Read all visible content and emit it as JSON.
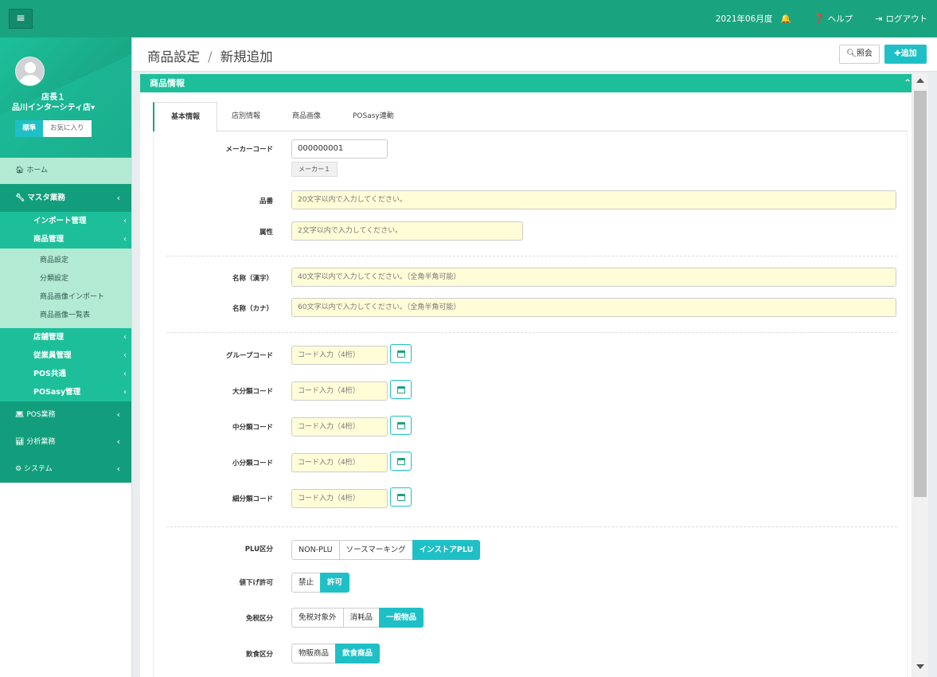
{
  "topbar": {
    "menu_icon": "hamburger-icon",
    "fiscal_period": "2021年06月度",
    "bell_icon": "bell-icon",
    "help_label": "ヘルプ",
    "logout_label": "ログアウト"
  },
  "sidebar": {
    "user_name": "店長１",
    "store_name": "品川インターシティ店▾",
    "fav_tabs": {
      "standard": "標準",
      "favorites": "お気に入り"
    },
    "home": "ホーム",
    "master": {
      "label": "マスタ業務"
    },
    "sub_items": [
      {
        "label": "インポート管理"
      },
      {
        "label": "商品管理"
      }
    ],
    "product_leafs": [
      "商品設定",
      "分類設定",
      "商品画像インポート",
      "商品画像一覧表"
    ],
    "more_sub_items": [
      {
        "label": "店舗管理"
      },
      {
        "label": "従業員管理"
      },
      {
        "label": "POS共通"
      },
      {
        "label": "POSasy管理"
      }
    ],
    "bottom_items": [
      {
        "label": "POS業務",
        "icon": "laptop-icon"
      },
      {
        "label": "分析業務",
        "icon": "bar-chart-icon"
      },
      {
        "label": "システム",
        "icon": "cogs-icon"
      }
    ]
  },
  "header": {
    "title_main": "商品設定",
    "title_sep": "/",
    "title_sub": "新規追加",
    "search_button": "照会",
    "add_button": "追加"
  },
  "panel": {
    "title": "商品情報",
    "tabs": [
      "基本情報",
      "店別情報",
      "商品画像",
      "POSasy連動"
    ]
  },
  "form": {
    "maker_code": {
      "label": "メーカーコード",
      "value": "000000001",
      "tag": "メーカー１"
    },
    "item_no": {
      "label": "品番",
      "placeholder": "20文字以内で入力してください。"
    },
    "attribute": {
      "label": "属性",
      "placeholder": "2文字以内で入力してください。"
    },
    "name_kanji": {
      "label": "名称（漢字）",
      "placeholder": "40文字以内で入力してください。（全角半角可能）"
    },
    "name_kana": {
      "label": "名称（カナ）",
      "placeholder": "60文字以内で入力してください。（全角半角可能）"
    },
    "codes": [
      {
        "label": "グループコード",
        "placeholder": "コード入力（4桁）"
      },
      {
        "label": "大分類コード",
        "placeholder": "コード入力（4桁）"
      },
      {
        "label": "中分類コード",
        "placeholder": "コード入力（4桁）"
      },
      {
        "label": "小分類コード",
        "placeholder": "コード入力（4桁）"
      },
      {
        "label": "細分類コード",
        "placeholder": "コード入力（4桁）"
      }
    ],
    "plu": {
      "label": "PLU区分",
      "options": [
        "NON-PLU",
        "ソースマーキング",
        "インストアPLU"
      ],
      "selected": 2
    },
    "discount": {
      "label": "値下げ許可",
      "options": [
        "禁止",
        "許可"
      ],
      "selected": 1
    },
    "tax_free": {
      "label": "免税区分",
      "options": [
        "免税対象外",
        "消耗品",
        "一般物品"
      ],
      "selected": 2
    },
    "food": {
      "label": "飲食区分",
      "options": [
        "物販商品",
        "飲食商品"
      ],
      "selected": 1
    }
  },
  "colors": {
    "topbar": "#1aa37f",
    "accent": "#1ec0c6",
    "panel_head": "#1cbf9a",
    "input_bg": "#fffdd8"
  }
}
